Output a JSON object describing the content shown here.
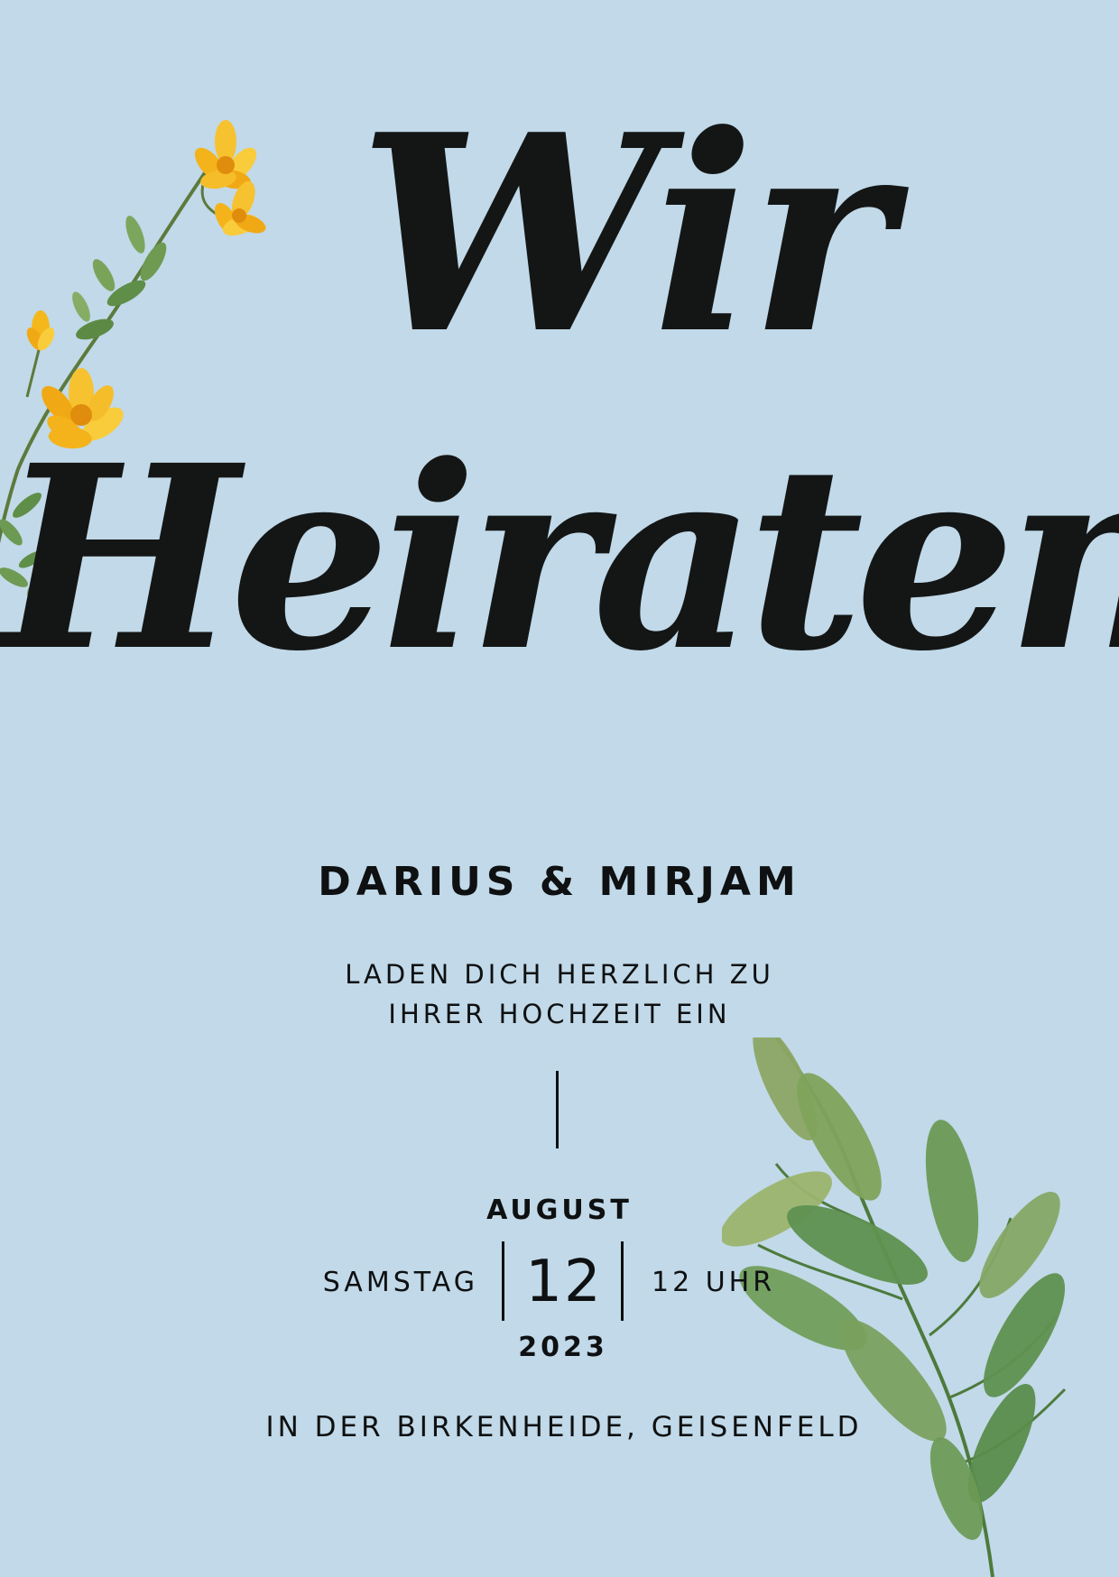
{
  "title": {
    "line1": "Wir",
    "line2": "Heiraten"
  },
  "couple": "DARIUS & MIRJAM",
  "invitation": {
    "line1": "LADEN DICH HERZLICH ZU",
    "line2": "IHRER HOCHZEIT EIN"
  },
  "date": {
    "month": "AUGUST",
    "weekday": "SAMSTAG",
    "day": "12",
    "time": "12 UHR",
    "year": "2023"
  },
  "venue": "IN DER BIRKENHEIDE, GEISENFELD",
  "colors": {
    "background": "#c1d9e8",
    "text": "#0e1011",
    "flower": "#f5b81c",
    "leaf": "#5e8f4e"
  }
}
